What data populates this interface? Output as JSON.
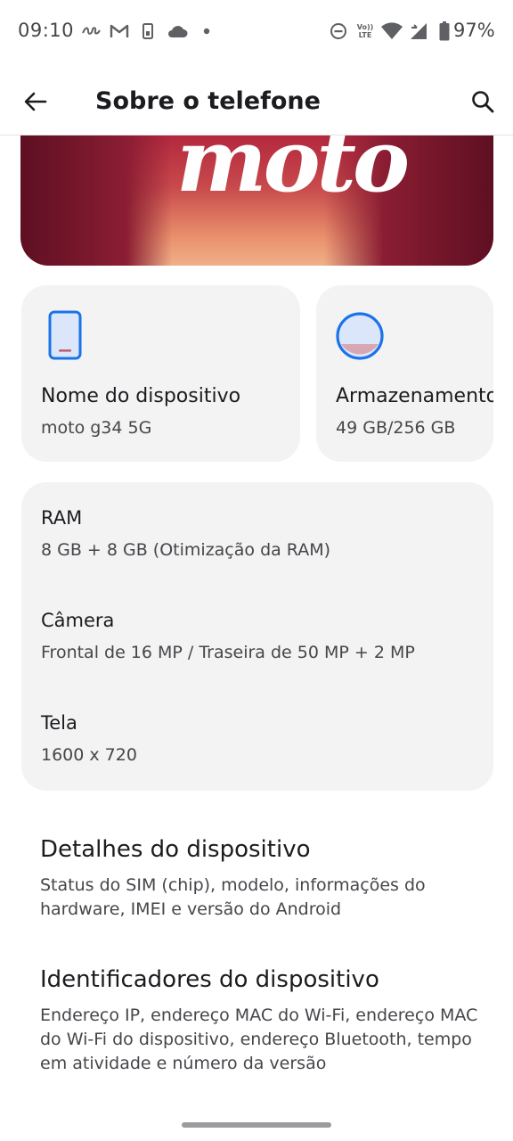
{
  "status_bar": {
    "time": "09:10",
    "battery_percent": "97%",
    "notification_icons": [
      "legal-app-icon",
      "gmail-icon",
      "sim-icon",
      "cloud-icon",
      "dot-icon"
    ],
    "system_icons": [
      "dnd-icon",
      "volte-icon",
      "wifi-icon",
      "signal-icon",
      "battery-icon"
    ],
    "volte_label": "Vo)) LTE"
  },
  "header": {
    "title": "Sobre o telefone"
  },
  "banner": {
    "logo_text": "moto"
  },
  "device_card": {
    "title": "Nome do dispositivo",
    "value": "moto g34 5G",
    "icon": "phone-icon",
    "accent": "#1a73e8"
  },
  "storage_card": {
    "title": "Armazenamento",
    "value": "49 GB/256 GB",
    "icon": "storage-ring-icon",
    "accent": "#1a73e8"
  },
  "specs": [
    {
      "title": "RAM",
      "value": "8 GB + 8 GB (Otimização da RAM)"
    },
    {
      "title": "Câmera",
      "value": "Frontal de 16 MP / Traseira de 50 MP + 2 MP"
    },
    {
      "title": "Tela",
      "value": "1600 x 720"
    }
  ],
  "sections": [
    {
      "title": "Detalhes do dispositivo",
      "subtitle": "Status do SIM (chip), modelo, informações do hardware, IMEI e versão do Android"
    },
    {
      "title": "Identificadores do dispositivo",
      "subtitle": "Endereço IP, endereço MAC do Wi-Fi, endereço MAC do Wi-Fi do dispositivo, endereço Bluetooth, tempo em atividade e número da versão"
    }
  ]
}
